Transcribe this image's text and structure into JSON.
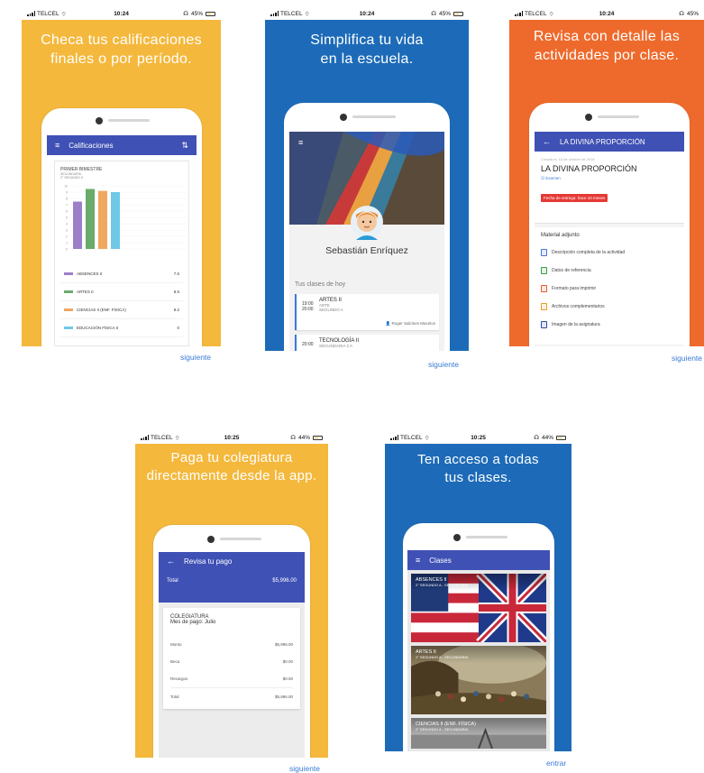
{
  "colors": {
    "yellow": "#f4b83c",
    "blue": "#1d6bb8",
    "orange": "#ee6a2c",
    "indigo": "#3f51b5",
    "link": "#3a7bd5"
  },
  "slides": {
    "grades": {
      "status": {
        "carrier": "TELCEL",
        "time": "10:24",
        "battery": "45%"
      },
      "headline": "Checa tus calificaciones\nfinales o por período.",
      "appbar_title": "Calificaciones",
      "period": "PRIMER BIMESTRE",
      "level": "SECUNDARIA",
      "group": "2° SEGUNDO II",
      "chart_data": {
        "type": "bar",
        "categories": [
          "ABSENCES II",
          "ARTES II",
          "CIENCIAS II (ENF. FÍSICA)",
          "EDUCACIÓN FÍSICA II"
        ],
        "values": [
          7.5,
          9.5,
          9.2,
          9.0
        ],
        "colors": [
          "#9c7fc8",
          "#6aab6a",
          "#f0a860",
          "#6fc8e8"
        ],
        "y_ticks": [
          "10",
          "9",
          "8",
          "7",
          "6",
          "5",
          "4",
          "3",
          "2",
          "1",
          "0"
        ],
        "ylim": [
          0,
          10
        ]
      },
      "grade_rows": [
        {
          "label": "ABSENCES II",
          "value": "7.5",
          "color": "#9c7fc8"
        },
        {
          "label": "ARTES II",
          "value": "9.5",
          "color": "#6aab6a"
        },
        {
          "label": "CIENCIAS II (ENF. FÍSICA)",
          "value": "9.2",
          "color": "#f0a860"
        },
        {
          "label": "EDUCACIÓN FÍSICA II",
          "value": "0",
          "color": "#6fc8e8"
        }
      ],
      "next": "siguiente"
    },
    "profile": {
      "status": {
        "carrier": "TELCEL",
        "time": "10:24",
        "battery": "45%"
      },
      "headline": "Simplifica tu vida\nen la escuela.",
      "name": "Sebastián Enríquez",
      "section_title": "Tus clases de hoy",
      "classes": [
        {
          "start": "19:00",
          "end": "20:00",
          "title": "ARTES II",
          "subject": "ARTE",
          "group": "SEGUNDO A",
          "teacher": "Roger Salcines Macelos"
        },
        {
          "start": "20:00",
          "end": "",
          "title": "TECNOLOGÍA II",
          "subject": "SECUNDARIA 2 A",
          "group": "",
          "teacher": ""
        }
      ],
      "next": "siguiente"
    },
    "activity": {
      "status": {
        "carrier": "TELCEL",
        "time": "10:24",
        "battery": "45%"
      },
      "headline": "Revisa con detalle las\nactividades por clase.",
      "appbar_title": "LA DIVINA PROPORCIÓN",
      "created": "Creada el: 15 de octubre de 2018",
      "title": "LA DIVINA PROPORCIÓN",
      "type": "Examen",
      "due_badge": "Fecha de entrega: hace 10 meses",
      "attachments_title": "Material adjunto",
      "attachments": [
        {
          "label": "Descripción completa de la actividad",
          "icon": "doc-icon",
          "color": "#4a6fd8"
        },
        {
          "label": "Datos de referencia",
          "icon": "sheet-icon",
          "color": "#3a9a4a"
        },
        {
          "label": "Formato para imprimir",
          "icon": "pdf-icon",
          "color": "#e85a2a"
        },
        {
          "label": "Archivos complementarios",
          "icon": "zip-icon",
          "color": "#f09a2a"
        },
        {
          "label": "Imagen de la asignatura",
          "icon": "image-icon",
          "color": "#2a4aa8"
        }
      ],
      "next": "siguiente"
    },
    "payment": {
      "status": {
        "carrier": "TELCEL",
        "time": "10:25",
        "battery": "44%"
      },
      "headline": "Paga tu colegiatura\ndirectamente desde la app.",
      "appbar_title": "Revisa tu pago",
      "total_label": "Total",
      "total_value": "$5,996.00",
      "concept": "COLEGIATURA",
      "month": "Mes de pago: Julio",
      "rows": [
        {
          "label": "Monto",
          "value": "$5,996.00"
        },
        {
          "label": "Beca",
          "value": "$0.00"
        },
        {
          "label": "Recargos",
          "value": "$0.00"
        },
        {
          "label": "Total",
          "value": "$5,996.00"
        }
      ],
      "next": "siguiente"
    },
    "classes": {
      "status": {
        "carrier": "TELCEL",
        "time": "10:25",
        "battery": "44%"
      },
      "headline": "Ten acceso a todas\ntus clases.",
      "appbar_title": "Clases",
      "cards": [
        {
          "title": "ABSENCES II",
          "subtitle": "2° SEGUNDO A - SECUNDARIA",
          "image": "flag"
        },
        {
          "title": "ARTES II",
          "subtitle": "2° SEGUNDO A - SECUNDARIA",
          "image": "painting"
        },
        {
          "title": "CIENCIAS II (ENF. FÍSICA)",
          "subtitle": "2° SEGUNDO A - SECUNDARIA",
          "image": "photo"
        }
      ],
      "next": "entrar"
    }
  }
}
